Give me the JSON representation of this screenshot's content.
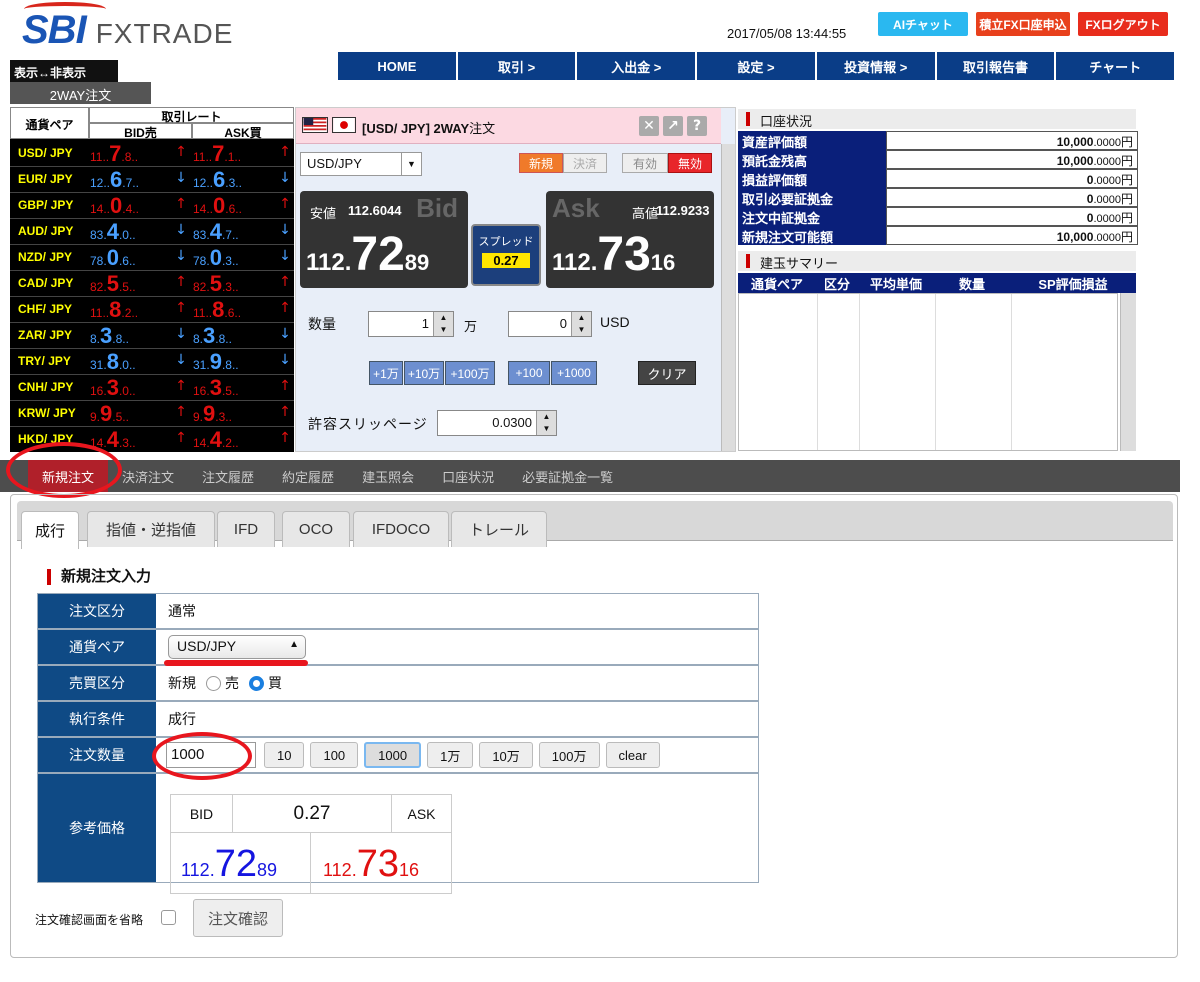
{
  "header": {
    "logo_sbi": "SBI",
    "logo_fx": "FXTRADE",
    "datetime": "2017/05/08 13:44:55",
    "buttons": {
      "ai_chat": "AIチャット",
      "tsumitate": "積立FX口座申込",
      "logout": "FXログアウト"
    },
    "nav": [
      "HOME",
      "取引 >",
      "入出金 >",
      "設定 >",
      "投資情報 >",
      "取引報告書",
      "チャート"
    ]
  },
  "rate_panel": {
    "toggle": "表示↔非表示",
    "tab": "2WAY注文",
    "hdr_pair": "通貨ペア",
    "hdr_rate": "取引レート",
    "hdr_bid": "BID売",
    "hdr_ask": "ASK買",
    "rows": [
      {
        "pair": "USD/ JPY",
        "bid_s": "11..",
        "bid_b": "7",
        "bid_e": ".8..",
        "ask_s": "11..",
        "ask_b": "7",
        "ask_e": ".1..",
        "color": "red",
        "bid_arr": "↑",
        "ask_arr": "↑"
      },
      {
        "pair": "EUR/ JPY",
        "bid_s": "12..",
        "bid_b": "6",
        "bid_e": ".7..",
        "ask_s": "12..",
        "ask_b": "6",
        "ask_e": ".3..",
        "color": "blue",
        "bid_arr": "↓",
        "ask_arr": "↓"
      },
      {
        "pair": "GBP/ JPY",
        "bid_s": "14..",
        "bid_b": "0",
        "bid_e": ".4..",
        "ask_s": "14..",
        "ask_b": "0",
        "ask_e": ".6..",
        "color": "red",
        "bid_arr": "↑",
        "ask_arr": "↑"
      },
      {
        "pair": "AUD/ JPY",
        "bid_s": "83.",
        "bid_b": "4",
        "bid_e": ".0..",
        "ask_s": "83.",
        "ask_b": "4",
        "ask_e": ".7..",
        "color": "blue",
        "bid_arr": "↓",
        "ask_arr": "↓"
      },
      {
        "pair": "NZD/ JPY",
        "bid_s": "78.",
        "bid_b": "0",
        "bid_e": ".6..",
        "ask_s": "78.",
        "ask_b": "0",
        "ask_e": ".3..",
        "color": "blue",
        "bid_arr": "↓",
        "ask_arr": "↓"
      },
      {
        "pair": "CAD/ JPY",
        "bid_s": "82.",
        "bid_b": "5",
        "bid_e": ".5..",
        "ask_s": "82.",
        "ask_b": "5",
        "ask_e": ".3..",
        "color": "red",
        "bid_arr": "↑",
        "ask_arr": "↑"
      },
      {
        "pair": "CHF/ JPY",
        "bid_s": "11..",
        "bid_b": "8",
        "bid_e": ".2..",
        "ask_s": "11..",
        "ask_b": "8",
        "ask_e": ".6..",
        "color": "red",
        "bid_arr": "↑",
        "ask_arr": "↑"
      },
      {
        "pair": "ZAR/ JPY",
        "bid_s": "8.",
        "bid_b": "3",
        "bid_e": ".8..",
        "ask_s": "8.",
        "ask_b": "3",
        "ask_e": ".8..",
        "color": "blue",
        "bid_arr": "↓",
        "ask_arr": "↓"
      },
      {
        "pair": "TRY/ JPY",
        "bid_s": "31.",
        "bid_b": "8",
        "bid_e": ".0..",
        "ask_s": "31.",
        "ask_b": "9",
        "ask_e": ".8..",
        "color": "blue",
        "bid_arr": "↓",
        "ask_arr": "↓"
      },
      {
        "pair": "CNH/ JPY",
        "bid_s": "16.",
        "bid_b": "3",
        "bid_e": ".0..",
        "ask_s": "16.",
        "ask_b": "3",
        "ask_e": ".5..",
        "color": "red",
        "bid_arr": "↑",
        "ask_arr": "↑"
      },
      {
        "pair": "KRW/ JPY",
        "bid_s": "9.",
        "bid_b": "9",
        "bid_e": ".5..",
        "ask_s": "9.",
        "ask_b": "9",
        "ask_e": ".3..",
        "color": "red",
        "bid_arr": "↑",
        "ask_arr": "↑"
      },
      {
        "pair": "HKD/ JPY",
        "bid_s": "14.",
        "bid_b": "4",
        "bid_e": ".3..",
        "ask_s": "14.",
        "ask_b": "4",
        "ask_e": ".2..",
        "color": "red",
        "bid_arr": "↑",
        "ask_arr": "↑"
      }
    ]
  },
  "two_way": {
    "title": "[USD/ JPY]  2WAY",
    "title_suffix": "注文",
    "pair_select": "USD/JPY",
    "btn_new": "新規",
    "btn_settle": "決済",
    "btn_valid_prefix": "有効",
    "btn_invalid": "無効",
    "low_label": "安値",
    "low_value": "112.6044",
    "high_label": "高値",
    "high_value": "112.9233",
    "bid_tag": "Bid",
    "ask_tag": "Ask",
    "bid_main": "112.",
    "bid_big": "72",
    "bid_small": "89",
    "ask_main": "112.",
    "ask_big": "73",
    "ask_small": "16",
    "spread_label": "スプレッド",
    "spread_value": "0.27",
    "qty_label": "数量",
    "qty_value": "1",
    "qty_unit": "万",
    "qty2_value": "0",
    "qty2_unit": "USD",
    "add_buttons": [
      "+1万",
      "+10万",
      "+100万"
    ],
    "add_buttons2": [
      "+100",
      "+1000"
    ],
    "clear": "クリア",
    "slip_label": "許容スリッページ",
    "slip_value": "0.0300"
  },
  "account": {
    "title": "口座状況",
    "rows": [
      {
        "k": "資産評価額",
        "int": "10,000",
        "dec": ".0000",
        "unit": "円"
      },
      {
        "k": "預託金残高",
        "int": "10,000",
        "dec": ".0000",
        "unit": "円"
      },
      {
        "k": "損益評価額",
        "int": "0",
        "dec": ".0000",
        "unit": "円"
      },
      {
        "k": "取引必要証拠金",
        "int": "0",
        "dec": ".0000",
        "unit": "円"
      },
      {
        "k": "注文中証拠金",
        "int": "0",
        "dec": ".0000",
        "unit": "円"
      },
      {
        "k": "新規注文可能額",
        "int": "10,000",
        "dec": ".0000",
        "unit": "円"
      }
    ],
    "summary_title": "建玉サマリー",
    "summary_cols": [
      "通貨ペア",
      "区分",
      "平均単価",
      "数量",
      "SP評価損益"
    ]
  },
  "tabs": [
    "新規注文",
    "決済注文",
    "注文履歴",
    "約定履歴",
    "建玉照会",
    "口座状況",
    "必要証拠金一覧"
  ],
  "subtabs": [
    "成行",
    "指値・逆指値",
    "IFD",
    "OCO",
    "IFDOCO",
    "トレール"
  ],
  "form": {
    "section_title": "新規注文入力",
    "type_label": "注文区分",
    "type_value": "通常",
    "pair_label": "通貨ペア",
    "pair_value": "USD/JPY",
    "side_label": "売買区分",
    "side_prefix": "新規",
    "side_sell": "売",
    "side_buy": "買",
    "exec_label": "執行条件",
    "exec_value": "成行",
    "qty_label": "注文数量",
    "qty_value": "1000",
    "qty_buttons": [
      "10",
      "100",
      "1000",
      "1万",
      "10万",
      "100万",
      "clear"
    ],
    "ref_label": "参考価格",
    "ref_bid": "BID",
    "ref_spread": "0.27",
    "ref_ask": "ASK",
    "ref_bid_main": "112.",
    "ref_bid_big": "72",
    "ref_bid_small": "89",
    "ref_ask_main": "112.",
    "ref_ask_big": "73",
    "ref_ask_small": "16",
    "skip_label": "注文確認画面を省略",
    "confirm": "注文確認"
  },
  "colors": {
    "nav": "#0a3d87",
    "highlight": "#e8161e",
    "bid_blue": "#1515e0",
    "ask_red": "#e01010"
  }
}
